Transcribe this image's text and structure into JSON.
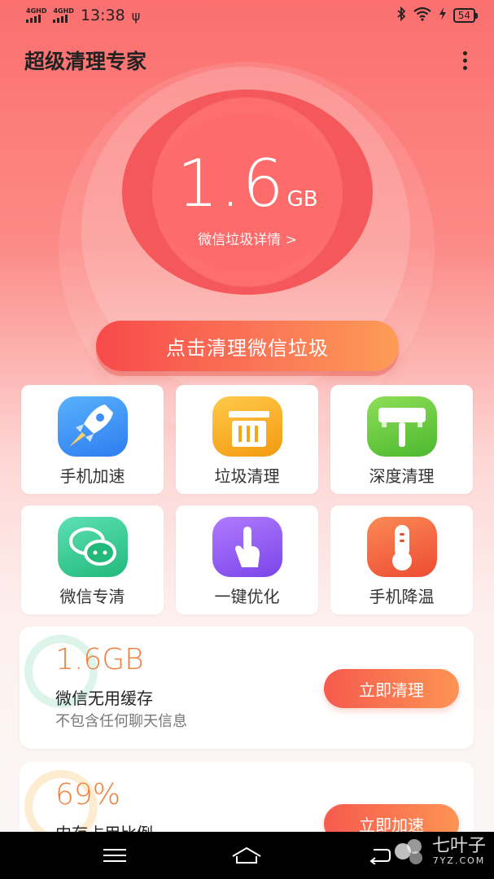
{
  "status_bar": {
    "net1": "4GHD",
    "net2": "4GHD",
    "time": "13:38",
    "battery": "54"
  },
  "header": {
    "title": "超级清理专家"
  },
  "gauge": {
    "value": "1.6",
    "unit": "GB",
    "link": "微信垃圾详情 >"
  },
  "clean_button": {
    "label": "点击清理微信垃圾"
  },
  "tools": [
    {
      "label": "手机加速",
      "icon": "rocket-icon",
      "color": "#3f8ef5"
    },
    {
      "label": "垃圾清理",
      "icon": "trash-icon",
      "color": "#f5a515"
    },
    {
      "label": "深度清理",
      "icon": "broom-icon",
      "color": "#5ec53b"
    },
    {
      "label": "微信专清",
      "icon": "wechat-icon",
      "color": "#34c98e"
    },
    {
      "label": "一键优化",
      "icon": "tap-icon",
      "color": "#8f5bf0"
    },
    {
      "label": "手机降温",
      "icon": "thermometer-icon",
      "color": "#f2603c"
    }
  ],
  "cards": [
    {
      "big": "1.6GB",
      "title": "微信无用缓存",
      "sub": "不包含任何聊天信息",
      "action": "立即清理"
    },
    {
      "big": "69%",
      "title": "内存占用比例",
      "action": "立即加速"
    }
  ],
  "watermark": {
    "main": "七叶子",
    "sub": "7YZ.COM"
  },
  "colors": {
    "accent": "#f74a4a",
    "card_number": "#f57e3c"
  }
}
